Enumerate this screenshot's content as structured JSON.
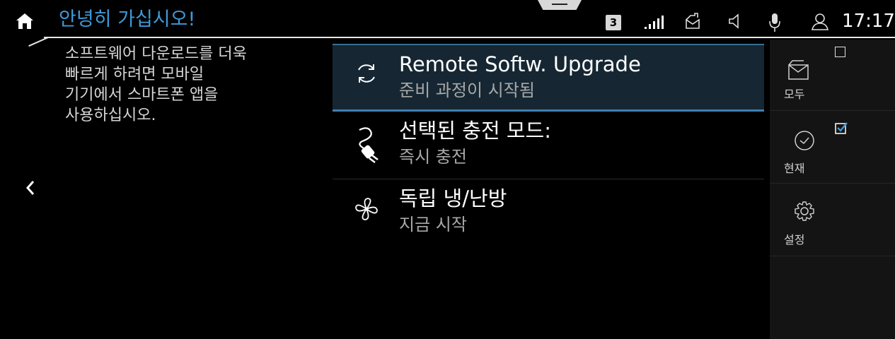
{
  "statusbar": {
    "greeting": "안녕히 가십시오!",
    "badge": "3",
    "time": "17:17",
    "icons": [
      "home-icon",
      "signal-icon",
      "message-icon",
      "speaker-icon",
      "microphone-icon",
      "user-icon"
    ]
  },
  "left": {
    "info_text": "소프트웨어 다운로드를 더욱\n빠르게 하려면 모바일\n기기에서 스마트폰 앱을\n사용하십시오.",
    "back_icon": "chevron-left-icon"
  },
  "list": {
    "items": [
      {
        "title": "Remote Softw. Upgrade",
        "subtitle": "준비 과정이 시작됨",
        "icon": "refresh-icon"
      },
      {
        "title": "선택된 충전 모드:",
        "subtitle": "즉시 충전",
        "icon": "charging-plug-icon"
      },
      {
        "title": "독립 냉/난방",
        "subtitle": "지금 시작",
        "icon": "fan-icon"
      }
    ]
  },
  "sidebar": {
    "items": [
      {
        "label": "모두",
        "icon": "message-icon",
        "checkbox": false
      },
      {
        "label": "현재",
        "icon": "clock-icon",
        "checkbox": true
      },
      {
        "label": "설정",
        "icon": "gear-icon"
      }
    ]
  },
  "colors": {
    "accent": "#3f9ad8",
    "selected_bg": "#162733",
    "sidebar_bg": "#141414"
  }
}
